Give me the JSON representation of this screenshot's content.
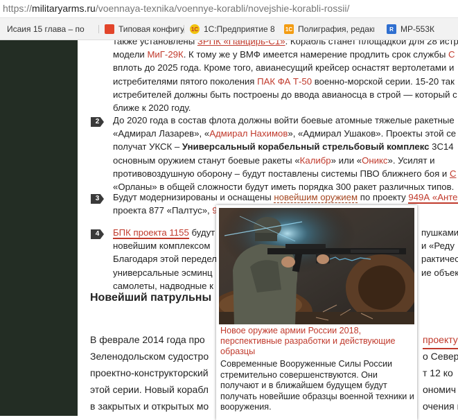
{
  "address_bar": {
    "host": "militaryarms.ru",
    "path": "/voennaya-texnika/voennye-korabli/novejshie-korabli-rossii/",
    "scheme": "https://"
  },
  "bookmarks": [
    {
      "label": "Исаия 15 глава – по",
      "color": "#ffffff"
    },
    {
      "label": "Типовая конфигурац",
      "color": "#e2452b"
    },
    {
      "label": "1С:Предприятие 8",
      "color": "#f1c40f"
    },
    {
      "label": "Полиграфия, редакц",
      "color": "#f39c12"
    },
    {
      "label": "МР-553К",
      "color": "#2f6fd0"
    }
  ],
  "article": {
    "block1": {
      "l1": [
        "также установлены ",
        "ЗРПК «Панцирь-С1»",
        ". Корабль станет площадкой для 28 истр"
      ],
      "l2": [
        "модели ",
        "МиГ-29К",
        ". К тому же у ВМФ имеется намерение продлить срок службы ",
        "С"
      ],
      "l3": "вплоть до 2025 года. Кроме того, авианесущий крейсер оснастят вертолетами и",
      "l4": [
        "истребителями пятого поколения ",
        "ПАК ФА Т-50",
        " военно-морской серии. 15-20 так"
      ],
      "l5": "истребителей должны быть построены до ввода авианосца в строй — который с",
      "l6": "ближе к 2020 году."
    },
    "item2": {
      "number": "2",
      "l1": "До 2020 года в состав флота должны войти боевые атомные тяжелые ракетные",
      "l2": [
        "«Адмирал Лазарев», «",
        "Адмирал Нахимов",
        "», «Адмирал Ушаков». Проекты этой се"
      ],
      "l3": [
        "получат УКСК – ",
        "Универсальный корабельный стрельбовый комплекс",
        " 3С14"
      ],
      "l4": [
        "основным оружием станут боевые ракеты «",
        "Калибр",
        "» или «",
        "Оникс",
        "». Усилят и"
      ],
      "l5": [
        "противовоздушную оборону – будут поставлены системы ПВО ближнего боя и ",
        "С"
      ],
      "l6": "«Орланы» в общей сложности будут иметь порядка 300 ракет различных типов."
    },
    "item3": {
      "number": "3",
      "l1": [
        "Будут модернизированы и оснащены ",
        "новейшим оружием",
        " по проекту ",
        "949А «Анте"
      ],
      "l2": [
        "проекта 877 «Палтус», ",
        "9",
        "»."
      ]
    },
    "item4": {
      "number": "4",
      "l1": [
        "БПК проекта 1155",
        " будут",
        " пушками"
      ],
      "l2": [
        "новейшим комплексом ",
        "и «Реду"
      ],
      "l3": [
        "Благодаря этой передел",
        "рактичес"
      ],
      "l4": [
        "универсальные эсминц",
        "ие объект"
      ],
      "l5": [
        "самолеты, надводные к",
        ""
      ]
    },
    "subheading": "Новейший патрульны",
    "bottom": {
      "l1": [
        "В феврале 2014 года про",
        "проекту 2"
      ],
      "l2": [
        "Зеленодольском судостро",
        "о Север"
      ],
      "l3": [
        "проектно-конструкторский",
        "т 12 ко"
      ],
      "l4": [
        "этой серии. Новый корабл",
        "ономич"
      ],
      "l5": [
        "в закрытых и открытых мо",
        "очения п"
      ]
    }
  },
  "hover_card": {
    "title": "Новое оружие армии России 2018, перспективные разработки и действующие образцы",
    "text": "Современные Вооруженные Силы России стремительно совершенствуются. Они получают и в ближайшем будущем будут получать новейшие образцы военной техники и вооружения."
  },
  "colors": {
    "link": "#c0392b",
    "sidebar": "#232d24"
  }
}
